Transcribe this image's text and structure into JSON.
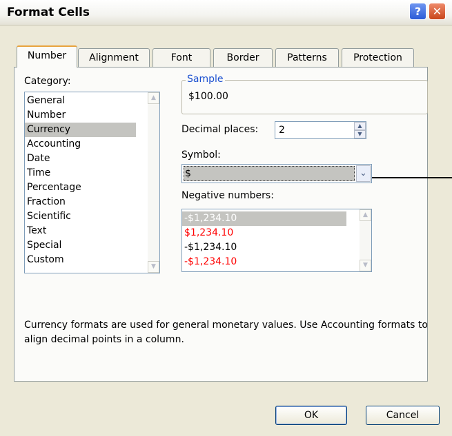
{
  "window": {
    "title": "Format Cells",
    "help_glyph": "?",
    "close_glyph": "✕"
  },
  "tabs": [
    {
      "label": "Number",
      "active": true
    },
    {
      "label": "Alignment",
      "active": false
    },
    {
      "label": "Font",
      "active": false
    },
    {
      "label": "Border",
      "active": false
    },
    {
      "label": "Patterns",
      "active": false
    },
    {
      "label": "Protection",
      "active": false
    }
  ],
  "category": {
    "label": "Category:",
    "items": [
      "General",
      "Number",
      "Currency",
      "Accounting",
      "Date",
      "Time",
      "Percentage",
      "Fraction",
      "Scientific",
      "Text",
      "Special",
      "Custom"
    ],
    "selected": "Currency"
  },
  "sample": {
    "label": "Sample",
    "value": "$100.00"
  },
  "decimal_places": {
    "label": "Decimal places:",
    "value": "2"
  },
  "symbol": {
    "label": "Symbol:",
    "value": "$"
  },
  "negative_numbers": {
    "label": "Negative numbers:",
    "items": [
      {
        "text": "-$1,234.10",
        "color": "#ffffff",
        "selected": true
      },
      {
        "text": "$1,234.10",
        "color": "#ff0000",
        "selected": false
      },
      {
        "text": "-$1,234.10",
        "color": "#000000",
        "selected": false
      },
      {
        "text": "-$1,234.10",
        "color": "#ff0000",
        "selected": false
      }
    ]
  },
  "description": "Currency formats are used for general monetary values.  Use Accounting formats to align decimal points in a column.",
  "buttons": {
    "ok": "OK",
    "cancel": "Cancel"
  },
  "icons": {
    "scroll_up": "▲",
    "scroll_down": "▼",
    "dropdown": "⌄"
  }
}
